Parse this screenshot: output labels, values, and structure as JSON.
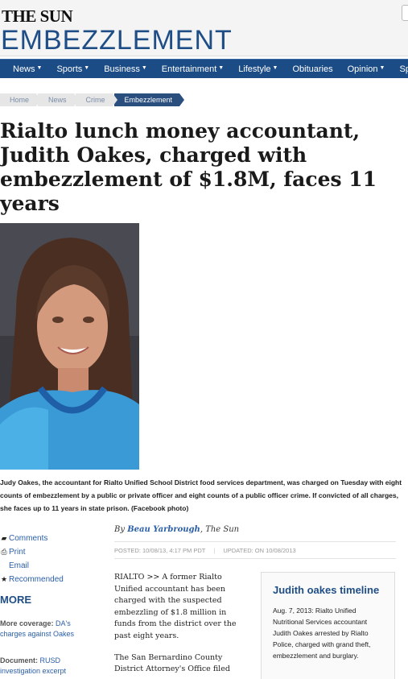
{
  "header": {
    "logo": "THE SUN",
    "section": "EMBEZZLEMENT"
  },
  "nav": {
    "items": [
      {
        "label": "News",
        "dropdown": true
      },
      {
        "label": "Sports",
        "dropdown": true
      },
      {
        "label": "Business",
        "dropdown": true
      },
      {
        "label": "Entertainment",
        "dropdown": true
      },
      {
        "label": "Lifestyle",
        "dropdown": true
      },
      {
        "label": "Obituaries",
        "dropdown": false
      },
      {
        "label": "Opinion",
        "dropdown": true
      },
      {
        "label": "Spe",
        "dropdown": false
      }
    ]
  },
  "breadcrumb": [
    "Home",
    "News",
    "Crime",
    "Embezzlement"
  ],
  "article": {
    "headline": "Rialto lunch money accountant, Judith Oakes, charged with embezzlement of $1.8M, faces 11 years",
    "caption": "Judy Oakes, the accountant for Rialto Unified School District food services department, was charged on Tuesday with eight counts of embezzlement by a public or private officer and eight counts of a public officer crime. If convicted of all charges, she faces up to 11 years in state prison. (Facebook photo)",
    "byline_prefix": "By",
    "author": "Beau Yarbrough",
    "publication": "The Sun",
    "posted": "POSTED: 10/08/13, 4:17 PM PDT",
    "updated": "UPDATED: ON 10/08/2013",
    "paragraphs": [
      "RIALTO >> A former Rialto Unified accountant has been charged with the suspected embezzling of $1.8 million in funds from the district over the past eight years.",
      "The San Bernardino County District Attorney's Office filed"
    ]
  },
  "tools": [
    {
      "label": "Comments",
      "icon": "comment-icon"
    },
    {
      "label": "Print",
      "icon": "print-icon"
    },
    {
      "label": "Email",
      "icon": "email-icon"
    },
    {
      "label": "Recommended",
      "icon": "star-icon"
    }
  ],
  "more": {
    "title": "MORE",
    "items": [
      {
        "label": "More coverage:",
        "link": "DA's charges against Oakes"
      },
      {
        "label": "Document:",
        "link": "RUSD investigation excerpt"
      }
    ]
  },
  "sidebar": {
    "title": "Judith oakes timeline",
    "text": "Aug. 7, 2013: Rialto Unified Nutritional Services accountant Judith Oakes arrested by Rialto Police, charged with grand theft, embezzlement and burglary."
  },
  "colors": {
    "brand": "#1f4e86",
    "nav_bg": "#1c4c86",
    "link": "#2a5ea8"
  }
}
